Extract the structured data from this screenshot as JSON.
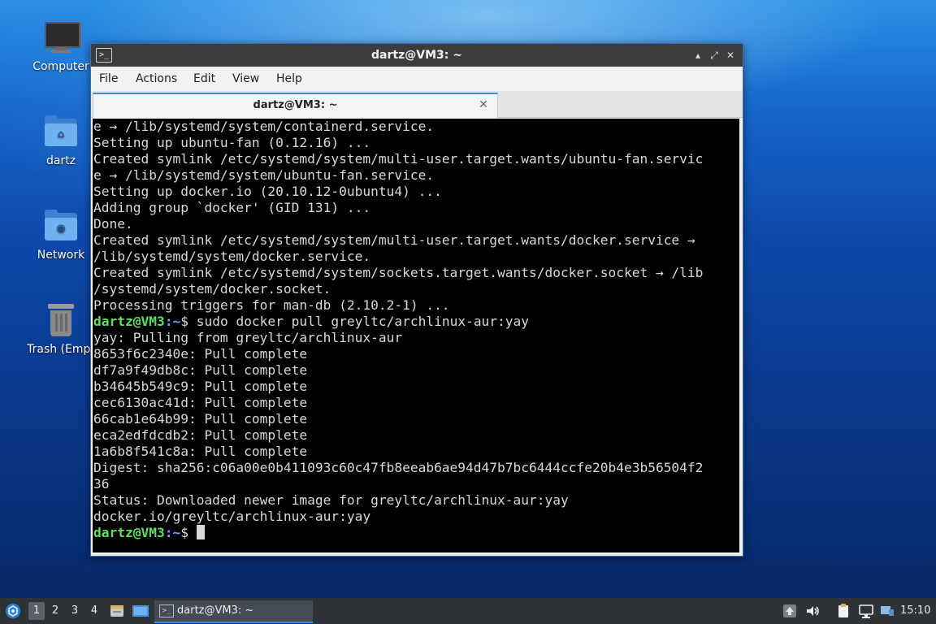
{
  "desktop": {
    "icons": [
      {
        "label": "Computer"
      },
      {
        "label": "dartz"
      },
      {
        "label": "Network"
      },
      {
        "label": "Trash (Empt"
      }
    ]
  },
  "window": {
    "title": "dartz@VM3: ~",
    "app_icon_glyph": ">_",
    "minimize_glyph": "▴",
    "maximize_glyph": "⤢",
    "close_glyph": "✕",
    "menu": [
      "File",
      "Actions",
      "Edit",
      "View",
      "Help"
    ],
    "tab": {
      "title": "dartz@VM3: ~",
      "close_glyph": "✕"
    }
  },
  "terminal": {
    "lines": [
      "e → /lib/systemd/system/containerd.service.",
      "Setting up ubuntu-fan (0.12.16) ...",
      "Created symlink /etc/systemd/system/multi-user.target.wants/ubuntu-fan.servic",
      "e → /lib/systemd/system/ubuntu-fan.service.",
      "Setting up docker.io (20.10.12-0ubuntu4) ...",
      "Adding group `docker' (GID 131) ...",
      "Done.",
      "Created symlink /etc/systemd/system/multi-user.target.wants/docker.service →",
      "/lib/systemd/system/docker.service.",
      "Created symlink /etc/systemd/system/sockets.target.wants/docker.socket → /lib",
      "/systemd/system/docker.socket.",
      "Processing triggers for man-db (2.10.2-1) ..."
    ],
    "prompt_user": "dartz@VM3",
    "prompt_path": ":~",
    "prompt_symbol": "$",
    "command": " sudo docker pull greyltc/archlinux-aur:yay",
    "output": [
      "yay: Pulling from greyltc/archlinux-aur",
      "8653f6c2340e: Pull complete",
      "df7a9f49db8c: Pull complete",
      "b34645b549c9: Pull complete",
      "cec6130ac41d: Pull complete",
      "66cab1e64b99: Pull complete",
      "eca2edfdcdb2: Pull complete",
      "1a6b8f541c8a: Pull complete",
      "Digest: sha256:c06a00e0b411093c60c47fb8eeab6ae94d47b7bc6444ccfe20b4e3b56504f2",
      "36",
      "Status: Downloaded newer image for greyltc/archlinux-aur:yay",
      "docker.io/greyltc/archlinux-aur:yay"
    ]
  },
  "taskbar": {
    "workspaces": [
      "1",
      "2",
      "3",
      "4"
    ],
    "active_workspace": "1",
    "task_title": "dartz@VM3: ~",
    "task_icon_glyph": ">_",
    "clock": "15:10"
  },
  "colors": {
    "prompt_user": "#5fe05f",
    "prompt_path": "#6ea6ff",
    "terminal_bg": "#000000",
    "accent": "#3b88d8"
  }
}
